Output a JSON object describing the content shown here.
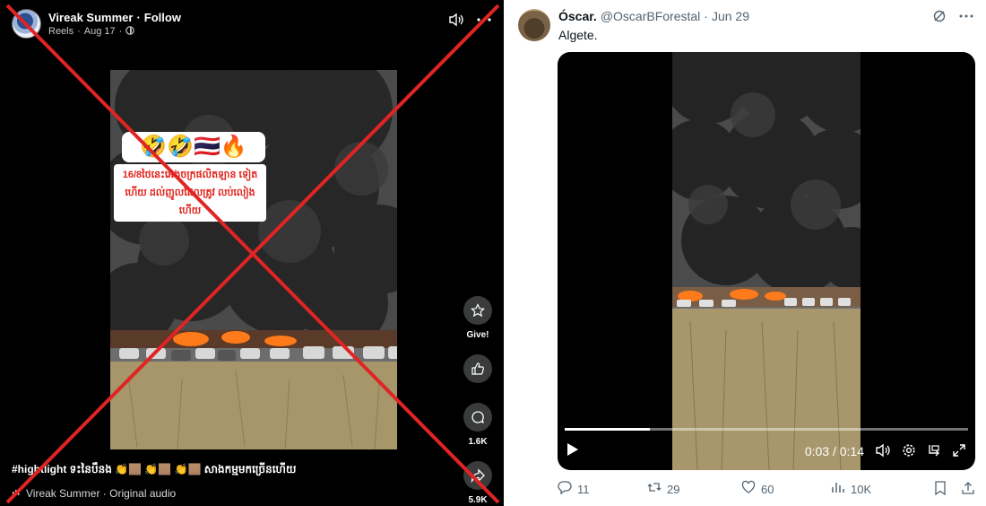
{
  "facebook": {
    "author": "Vireak Summer",
    "separator": "·",
    "follow_label": "Follow",
    "sub_reels": "Reels",
    "sub_date": "Aug 17",
    "overlay_emoji": "🤣🤣🇹🇭🔥",
    "overlay_text": "16/8ថៃនេះអេងចក្រផលិតឡាន ទៀតហើយ ដល់ញូលដែលត្រូវ លប់លៀងហើយ",
    "rail": {
      "give_label": "Give!",
      "comments_count": "1.6K",
      "shares_count": "5.9K"
    },
    "caption": "#hightlight ទះនៃបឹនង 👏🏽 👏🏽 👏🏽 សាងកម្មមកច្រើនហើយ",
    "audio": "Vireak Summer · Original audio",
    "icons": [
      "volume-icon",
      "more-icon",
      "star-give-icon",
      "like-icon",
      "comment-icon",
      "share-icon",
      "globe-icon",
      "music-icon"
    ],
    "cross_color": "#e02424"
  },
  "twitter": {
    "name": "Óscar.",
    "handle": "@OscarBForestal",
    "separator": "·",
    "date": "Jun 29",
    "text": "Algete.",
    "video": {
      "time": "0:03 / 0:14",
      "progress": 0.21
    },
    "actions": {
      "replies": "11",
      "reposts": "29",
      "likes": "60",
      "views": "10K"
    },
    "icons": [
      "grok-icon",
      "more-icon",
      "play-icon",
      "volume-icon",
      "settings-icon",
      "pip-icon",
      "fullscreen-icon",
      "reply-icon",
      "repost-icon",
      "like-icon",
      "views-icon",
      "bookmark-icon",
      "share-icon"
    ]
  }
}
